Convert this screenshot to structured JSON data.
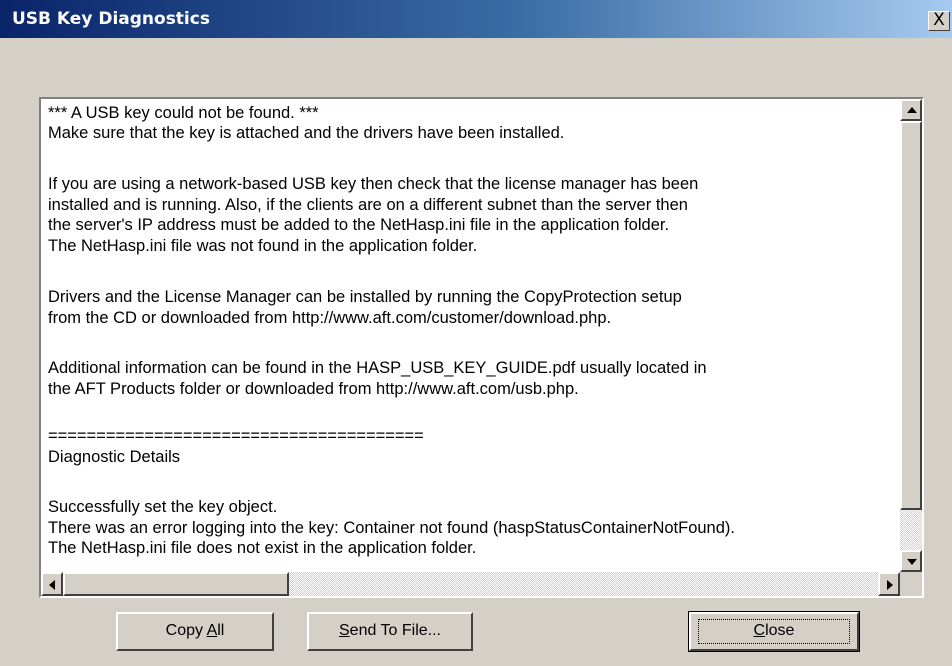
{
  "window": {
    "title": "USB Key Diagnostics",
    "close_glyph": "X"
  },
  "report": {
    "lines": [
      "*** A USB key could not be found. ***",
      "Make sure that the key is attached and the drivers have been installed.",
      "",
      "If you are using a network-based USB key then check that the license manager has been",
      "installed and is running. Also, if the clients are on a different subnet than the server then",
      "the server's IP address must be added to the NetHasp.ini file in the application folder.",
      "The NetHasp.ini file was not found in the application folder.",
      "",
      "Drivers and the License Manager can be installed by running the CopyProtection setup",
      "from the CD or downloaded from http://www.aft.com/customer/download.php.",
      "",
      "Additional information can be found in the HASP_USB_KEY_GUIDE.pdf usually located in",
      "the AFT Products folder or downloaded from http://www.aft.com/usb.php.",
      "",
      "=======================================",
      "Diagnostic Details",
      "",
      "Successfully set the key object.",
      "There was an error logging into the key: Container not found (haspStatusContainerNotFound).",
      "The NetHasp.ini file does not exist in the application folder."
    ]
  },
  "buttons": {
    "copy_all": {
      "pre": "Copy ",
      "accel": "A",
      "post": "ll"
    },
    "send_to_file": {
      "pre": "",
      "accel": "S",
      "post": "end To File..."
    },
    "close": {
      "pre": "",
      "accel": "C",
      "post": "lose"
    }
  },
  "icons": {
    "close": "close-icon",
    "scroll_up": "up-arrow-icon",
    "scroll_down": "down-arrow-icon",
    "scroll_left": "left-arrow-icon",
    "scroll_right": "right-arrow-icon"
  }
}
